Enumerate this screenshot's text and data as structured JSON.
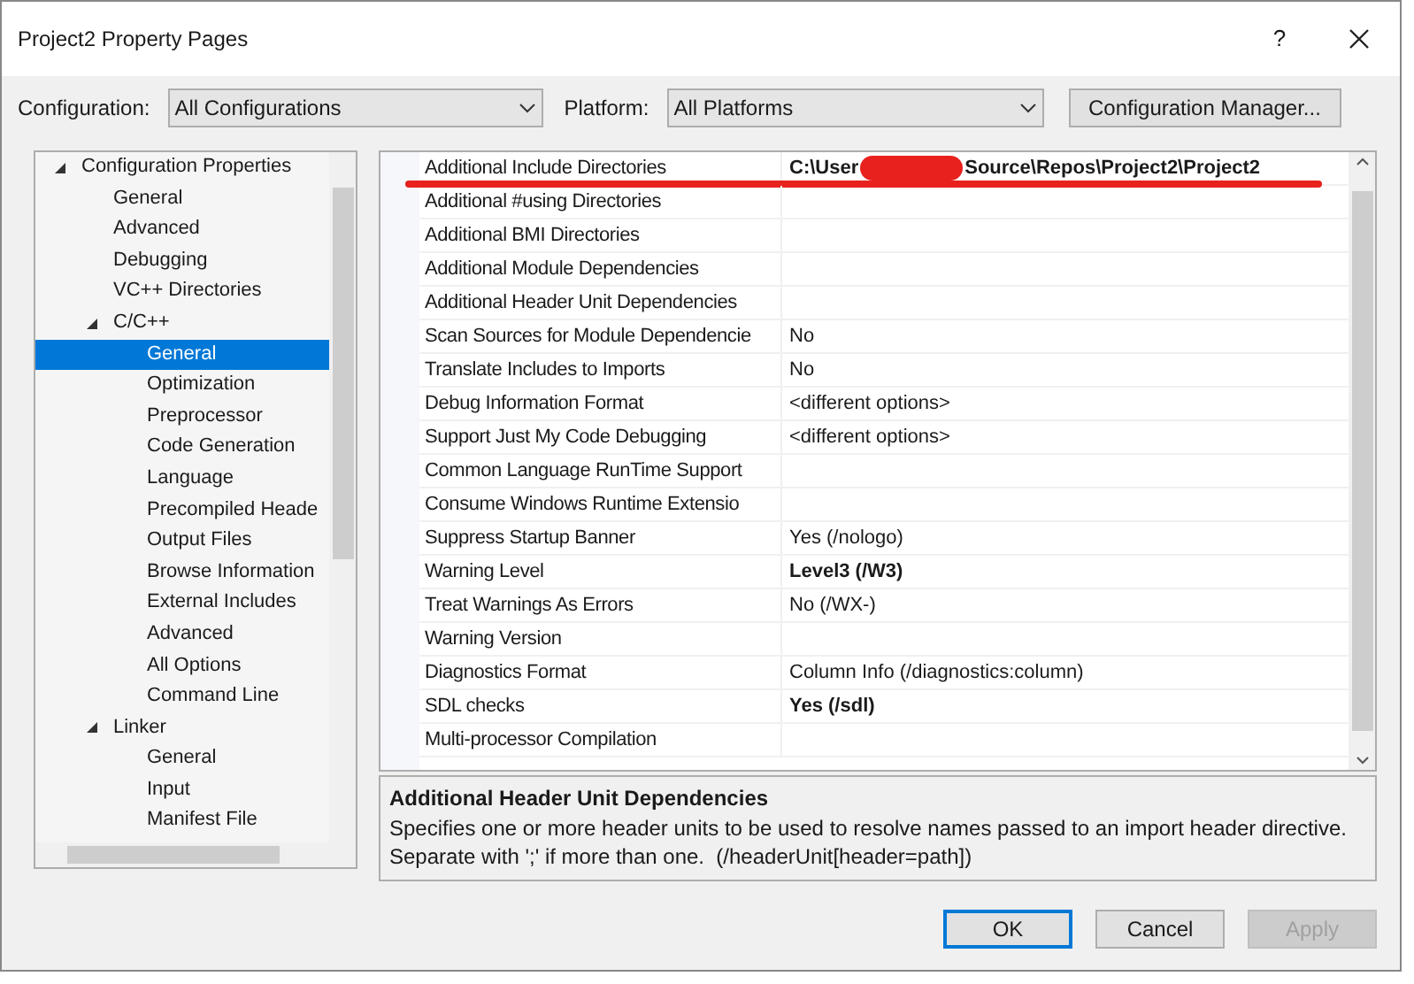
{
  "window": {
    "title": "Project2 Property Pages",
    "help": "?"
  },
  "toolbar": {
    "configuration_label": "Configuration:",
    "configuration_value": "All Configurations",
    "platform_label": "Platform:",
    "platform_value": "All Platforms",
    "manager_button": "Configuration Manager..."
  },
  "tree": [
    {
      "label": "Configuration Properties",
      "expanded": true,
      "selected": false,
      "children": [
        {
          "label": "General",
          "selected": false
        },
        {
          "label": "Advanced",
          "selected": false
        },
        {
          "label": "Debugging",
          "selected": false
        },
        {
          "label": "VC++ Directories",
          "selected": false
        },
        {
          "label": "C/C++",
          "expanded": true,
          "selected": false,
          "children": [
            {
              "label": "General",
              "selected": true
            },
            {
              "label": "Optimization",
              "selected": false
            },
            {
              "label": "Preprocessor",
              "selected": false
            },
            {
              "label": "Code Generation",
              "selected": false
            },
            {
              "label": "Language",
              "selected": false
            },
            {
              "label": "Precompiled Heade",
              "selected": false
            },
            {
              "label": "Output Files",
              "selected": false
            },
            {
              "label": "Browse Information",
              "selected": false
            },
            {
              "label": "External Includes",
              "selected": false
            },
            {
              "label": "Advanced",
              "selected": false
            },
            {
              "label": "All Options",
              "selected": false
            },
            {
              "label": "Command Line",
              "selected": false
            }
          ]
        },
        {
          "label": "Linker",
          "expanded": true,
          "selected": false,
          "children": [
            {
              "label": "General",
              "selected": false
            },
            {
              "label": "Input",
              "selected": false
            },
            {
              "label": "Manifest File",
              "selected": false
            }
          ]
        }
      ]
    }
  ],
  "properties": [
    {
      "name": "Additional Include Directories",
      "value": "C:\\User",
      "value_after_redaction": "Source\\Repos\\Project2\\Project2",
      "redacted": true,
      "underlined": true,
      "bold": true
    },
    {
      "name": "Additional #using Directories"
    },
    {
      "name": "Additional BMI Directories"
    },
    {
      "name": "Additional Module Dependencies"
    },
    {
      "name": "Additional Header Unit Dependencies"
    },
    {
      "name": "Scan Sources for Module Dependencie",
      "value": "No",
      "bold": false
    },
    {
      "name": "Translate Includes to Imports",
      "value": "No",
      "bold": false
    },
    {
      "name": "Debug Information Format",
      "value": "<different options>",
      "bold": false
    },
    {
      "name": "Support Just My Code Debugging",
      "value": "<different options>",
      "bold": false
    },
    {
      "name": "Common Language RunTime Support"
    },
    {
      "name": "Consume Windows Runtime Extensio"
    },
    {
      "name": "Suppress Startup Banner",
      "value": "Yes (/nologo)",
      "bold": false
    },
    {
      "name": "Warning Level",
      "value": "Level3 (/W3)",
      "bold": true
    },
    {
      "name": "Treat Warnings As Errors",
      "value": "No (/WX-)",
      "bold": false
    },
    {
      "name": "Warning Version"
    },
    {
      "name": "Diagnostics Format",
      "value": "Column Info (/diagnostics:column)",
      "bold": false
    },
    {
      "name": "SDL checks",
      "value": "Yes (/sdl)",
      "bold": true
    },
    {
      "name": "Multi-processor Compilation"
    }
  ],
  "description": {
    "title": "Additional Header Unit Dependencies",
    "text": "Specifies one or more header units to be used to resolve names passed to an import header directive. Separate with ';' if more than one.  (/headerUnit[header=path])"
  },
  "buttons": [
    {
      "label": "OK",
      "kind": "default",
      "disabled": false
    },
    {
      "label": "Cancel",
      "kind": "normal",
      "disabled": false
    },
    {
      "label": "Apply",
      "kind": "normal",
      "disabled": true
    }
  ]
}
